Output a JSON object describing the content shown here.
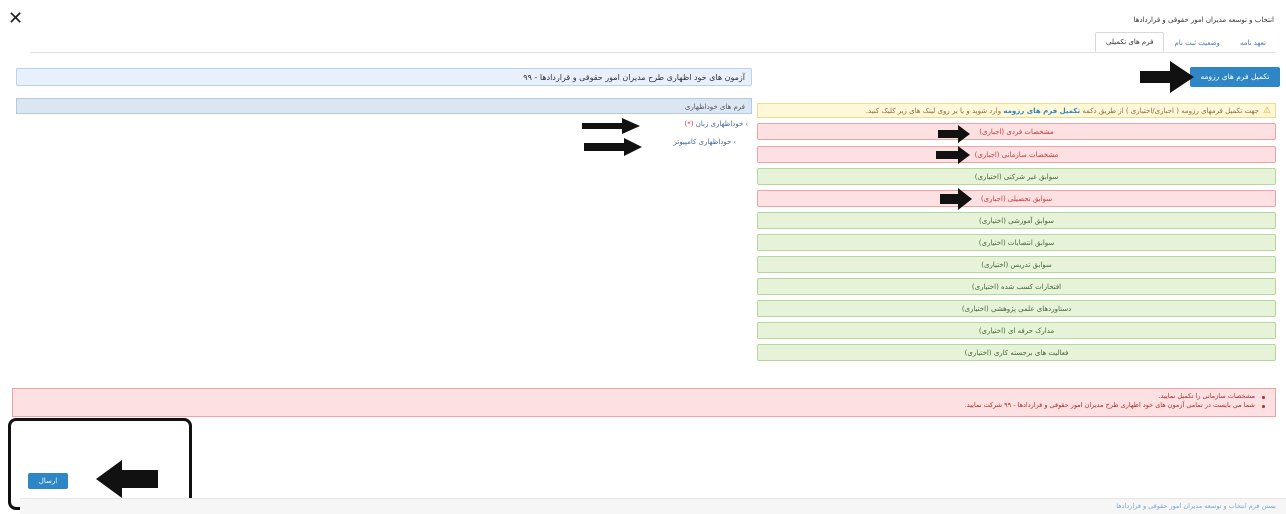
{
  "window": {
    "close_symbol": "✕"
  },
  "breadcrumb": "انتخاب و توسعه مدیران امور حقوقی و قراردادها",
  "tabs": [
    {
      "label": "تعهد نامه",
      "active": false
    },
    {
      "label": "وضعیت ثبت نام",
      "active": false
    },
    {
      "label": "فرم های تکمیلی",
      "active": true
    }
  ],
  "exam_title": "آزمون های خود اظهاری طرح مدیران امور حقوقی و قراردادها - ۹۹",
  "complete_button": "تکمیل فرم های رزومه",
  "self_declaration": {
    "header": "فرم های خوداظهاری",
    "items": [
      {
        "label": "خوداظهاری زبان",
        "mark": "(*)"
      },
      {
        "label": "خوداظهاری کامپیوتر",
        "mark": ""
      }
    ]
  },
  "notice": {
    "part1": "جهت تکمیل فرمهای رزومه ( اجباری/اختیاری ) از طریق دکمه",
    "bold": "تکمیل فرم های رزومه",
    "part2": "وارد شوید و یا بر روی لینک های زیر کلیک کنید."
  },
  "forms": [
    {
      "label": "مشخصات فردی (اجباری)",
      "required": true
    },
    {
      "label": "مشخصات سازمانی (اجباری)",
      "required": true
    },
    {
      "label": "سوابق غیر شرکتی (اختیاری)",
      "required": false
    },
    {
      "label": "سوابق تحصیلی (اجباری)",
      "required": true
    },
    {
      "label": "سوابق آموزشی (اختیاری)",
      "required": false
    },
    {
      "label": "سوابق انتصابات (اختیاری)",
      "required": false
    },
    {
      "label": "سوابق تدریس (اختیاری)",
      "required": false
    },
    {
      "label": "افتخارات کسب شده (اختیاری)",
      "required": false
    },
    {
      "label": "دستاوردهای علمی پژوهشی (اختیاری)",
      "required": false
    },
    {
      "label": "مدارک حرفه ای (اختیاری)",
      "required": false
    },
    {
      "label": "فعالیت های برجسته کاری (اختیاری)",
      "required": false
    }
  ],
  "errors": [
    "مشخصات سازمانی را تکمیل نمایید.",
    "شما می بایست در تمامی آزمون های خود اظهاری طرح مدیران امور حقوقی و قراردادها - ۹۹ شرکت نمایید."
  ],
  "send_button": "ارسال",
  "footer_link": "بستن فرم انتخاب و توسعه مدیران امور حقوقی و قراردادها",
  "colors": {
    "primary": "#2f86c6",
    "required_bg": "#fde1e2",
    "optional_bg": "#e6f3d8",
    "notice_bg": "#fff8d8"
  }
}
